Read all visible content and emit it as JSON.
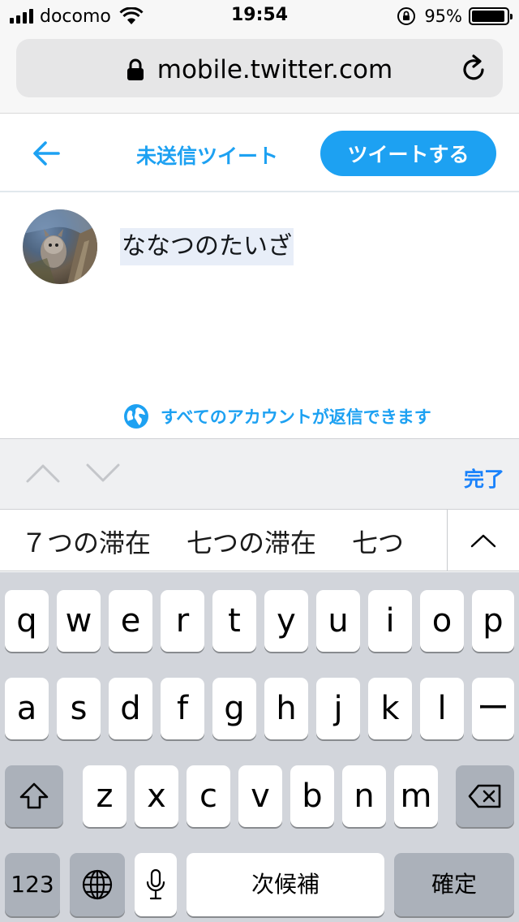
{
  "status_bar": {
    "carrier": "docomo",
    "time": "19:54",
    "battery_percent": "95%",
    "battery_level": 0.95
  },
  "browser": {
    "url": "mobile.twitter.com"
  },
  "header": {
    "drafts_label": "未送信ツイート",
    "tweet_button_label": "ツイートする"
  },
  "compose": {
    "text": "ななつのたいざ",
    "reply_setting": "すべてのアカウントが返信できます"
  },
  "accessory": {
    "done_label": "完了"
  },
  "candidates": [
    "７つの滞在",
    "七つの滞在",
    "七つ"
  ],
  "keyboard": {
    "row1": [
      "q",
      "w",
      "e",
      "r",
      "t",
      "y",
      "u",
      "i",
      "o",
      "p"
    ],
    "row2": [
      "a",
      "s",
      "d",
      "f",
      "g",
      "h",
      "j",
      "k",
      "l",
      "ー"
    ],
    "row3": [
      "z",
      "x",
      "c",
      "v",
      "b",
      "n",
      "m"
    ],
    "numbers_label": "123",
    "space_label": "次候補",
    "return_label": "確定"
  },
  "colors": {
    "accent": "#1da1f2",
    "ios_blue": "#1a82fb",
    "keyboard_bg": "#d2d5db"
  },
  "icons": [
    "signal-icon",
    "wifi-icon",
    "rotation-lock-icon",
    "battery-icon",
    "lock-icon",
    "reload-icon",
    "back-arrow-icon",
    "globe-icon",
    "chevron-up-icon",
    "chevron-down-icon",
    "shift-icon",
    "backspace-icon",
    "globe-key-icon",
    "microphone-icon"
  ]
}
